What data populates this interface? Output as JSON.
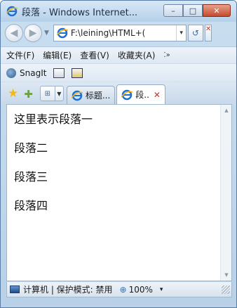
{
  "window": {
    "title": "段落 - Windows Internet...",
    "caption": {
      "minimize": "–",
      "maximize": "□",
      "close": "✕"
    }
  },
  "nav": {
    "back_icon": "back-arrow-icon",
    "forward_icon": "forward-arrow-icon",
    "address": "F:\\leining\\HTML+(",
    "address_drop": "▾",
    "refresh": "↺"
  },
  "menu": {
    "items": [
      "文件(F)",
      "编辑(E)",
      "查看(V)",
      "收藏夹(A)"
    ],
    "more": "⁚»"
  },
  "toolbar": {
    "snagit_label": "SnagIt"
  },
  "tabs": {
    "quick_tabs": "⊞",
    "items": [
      {
        "label": "标题...",
        "active": false
      },
      {
        "label": "段..",
        "active": true,
        "close": "✕"
      }
    ]
  },
  "content": {
    "paragraphs": [
      "这里表示段落一",
      "段落二",
      "段落三",
      "段落四"
    ]
  },
  "status": {
    "zone": "计算机 | 保护模式: 禁用",
    "zoom": "100%",
    "zoom_drop": "▾"
  },
  "colors": {
    "accent": "#2a71c2",
    "frame": "#b8d1e8",
    "close_button": "#c34b2e"
  }
}
